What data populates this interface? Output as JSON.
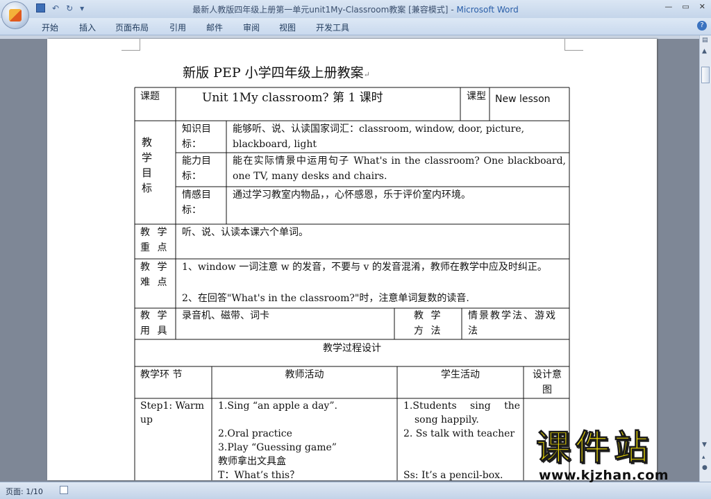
{
  "window": {
    "title": "最新人教版四年级上册第一单元unit1My-Classroom教案 [兼容模式]",
    "app_name": "Microsoft Word",
    "separator": " - "
  },
  "ribbon_tabs": [
    "开始",
    "插入",
    "页面布局",
    "引用",
    "邮件",
    "审阅",
    "视图",
    "开发工具"
  ],
  "document": {
    "title": "新版 PEP 小学四年级上册教案",
    "table": {
      "lesson_label": "课题",
      "lesson_title": "Unit 1My classroom? 第 1 课时",
      "type_label": "课型",
      "type_value": "New lesson",
      "goals_label": "教学目标",
      "goals": [
        {
          "label": "知识目标：",
          "text": "能够听、说、认读国家词汇：classroom, window, door, picture, blackboard, light"
        },
        {
          "label": "能力目标：",
          "text": "能在实际情景中运用句子 What's in the classroom? One blackboard, one TV, many desks and chairs."
        },
        {
          "label": "情感目标：",
          "text": "通过学习教室内物品，，心怀感恩，乐于评价室内环境。"
        }
      ],
      "key_label": "教 学 重 点",
      "key_text": "听、说、认读本课六个单词。",
      "difficulty_label": "教 学 难 点",
      "difficulty_1": "1、window 一词注意 w 的发音，不要与 v 的发音混淆，教师在教学中应及时纠正。",
      "difficulty_2": "2、在回答\"What's in the classroom?\"时，注意单词复数的读音.",
      "tools_label": "教 学 用 具",
      "tools_text": "录音机、磁带、词卡",
      "method_label": "教 学 方 法",
      "method_text": "情景教学法、游戏法",
      "process_title": "教学过程设计",
      "col_headers": [
        "教学环 节",
        "教师活动",
        "学生活动",
        "设计意图"
      ],
      "step1_label": "Step1: Warm up",
      "teacher_lines": [
        "1.Sing “an apple a day”.",
        "2.Oral practice",
        "3.Play “Guessing game”",
        "教师拿出文具盒",
        "T：What’s this？"
      ],
      "student_lines": [
        "1.Students sing the song happily.",
        "2. Ss talk with teacher",
        "Ss: It’s a pencil-box."
      ]
    }
  },
  "status": {
    "page_indicator": "页面: 1/10"
  },
  "watermark": {
    "brand": "课件站",
    "url": "www.kjzhan.com"
  }
}
